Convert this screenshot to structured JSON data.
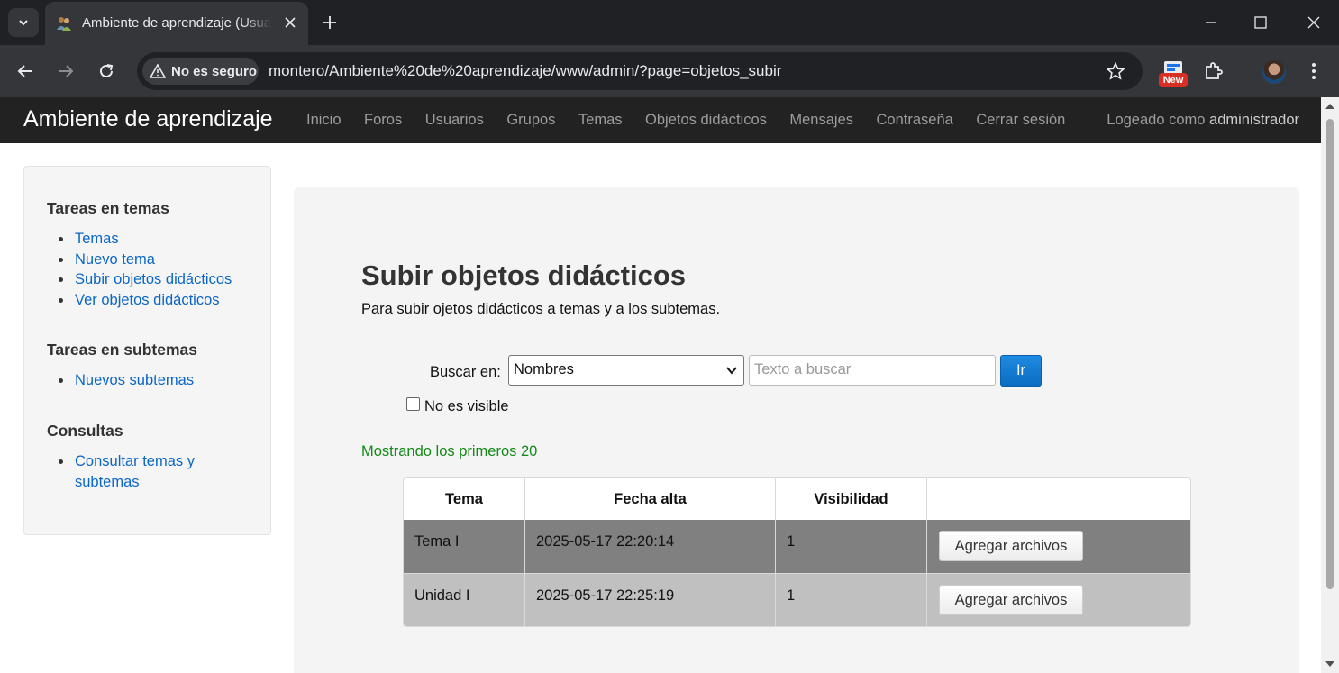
{
  "browser": {
    "tab_title": "Ambiente de aprendizaje (Usuarios)",
    "security_label": "No es seguro",
    "url": "montero/Ambiente%20de%20aprendizaje/www/admin/?page=objetos_subir",
    "extension_badge": "New"
  },
  "site": {
    "brand": "Ambiente de aprendizaje",
    "nav": [
      "Inicio",
      "Foros",
      "Usuarios",
      "Grupos",
      "Temas",
      "Objetos didácticos",
      "Mensajes",
      "Contraseña",
      "Cerrar sesión"
    ],
    "user_prefix": "Logeado como",
    "user_name": "administrador"
  },
  "sidebar": {
    "sections": [
      {
        "heading": "Tareas en temas",
        "items": [
          "Temas",
          "Nuevo tema",
          "Subir objetos didácticos",
          "Ver objetos didácticos"
        ]
      },
      {
        "heading": "Tareas en subtemas",
        "items": [
          "Nuevos subtemas"
        ]
      },
      {
        "heading": "Consultas",
        "items": [
          "Consultar temas y",
          "subtemas"
        ]
      }
    ]
  },
  "main": {
    "title": "Subir objetos didácticos",
    "subtitle": "Para subir ojetos didácticos a temas y a los subtemas.",
    "search_label": "Buscar en:",
    "search_field_value": "Nombres",
    "search_placeholder": "Texto a buscar",
    "search_button": "Ir",
    "checkbox_label": "No es visible",
    "checkbox_checked": false,
    "status": "Mostrando los primeros 20",
    "table": {
      "headers": [
        "Tema",
        "Fecha alta",
        "Visibilidad",
        ""
      ],
      "rows": [
        {
          "tema": "Tema I",
          "fecha": "2025-05-17 22:20:14",
          "visibilidad": "1",
          "action": "Agregar archivos"
        },
        {
          "tema": "Unidad I",
          "fecha": "2025-05-17 22:25:19",
          "visibilidad": "1",
          "action": "Agregar archivos"
        }
      ]
    }
  },
  "colors": {
    "navbar": "#222222",
    "link": "#0b66c6",
    "status_text": "#138a17",
    "row_dark": "#808080",
    "row_light": "#c0c0c0",
    "button_primary": "#0a6dc1"
  }
}
